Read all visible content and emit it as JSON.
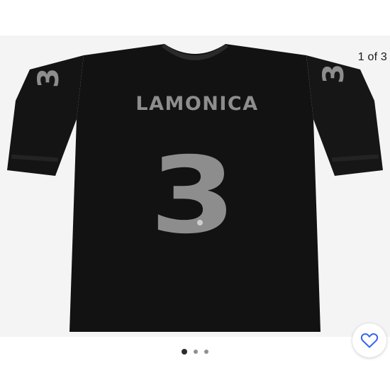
{
  "gallery": {
    "counter": "1 of 3",
    "jersey": {
      "name": "LAMONICA",
      "number": "3",
      "body_color": "#141414",
      "lettering_color": "#8d8d8d"
    },
    "dots": [
      {
        "active": true
      },
      {
        "active": false
      },
      {
        "active": false
      }
    ],
    "favorite_icon": "heart-icon",
    "accent_color": "#3665f3"
  }
}
